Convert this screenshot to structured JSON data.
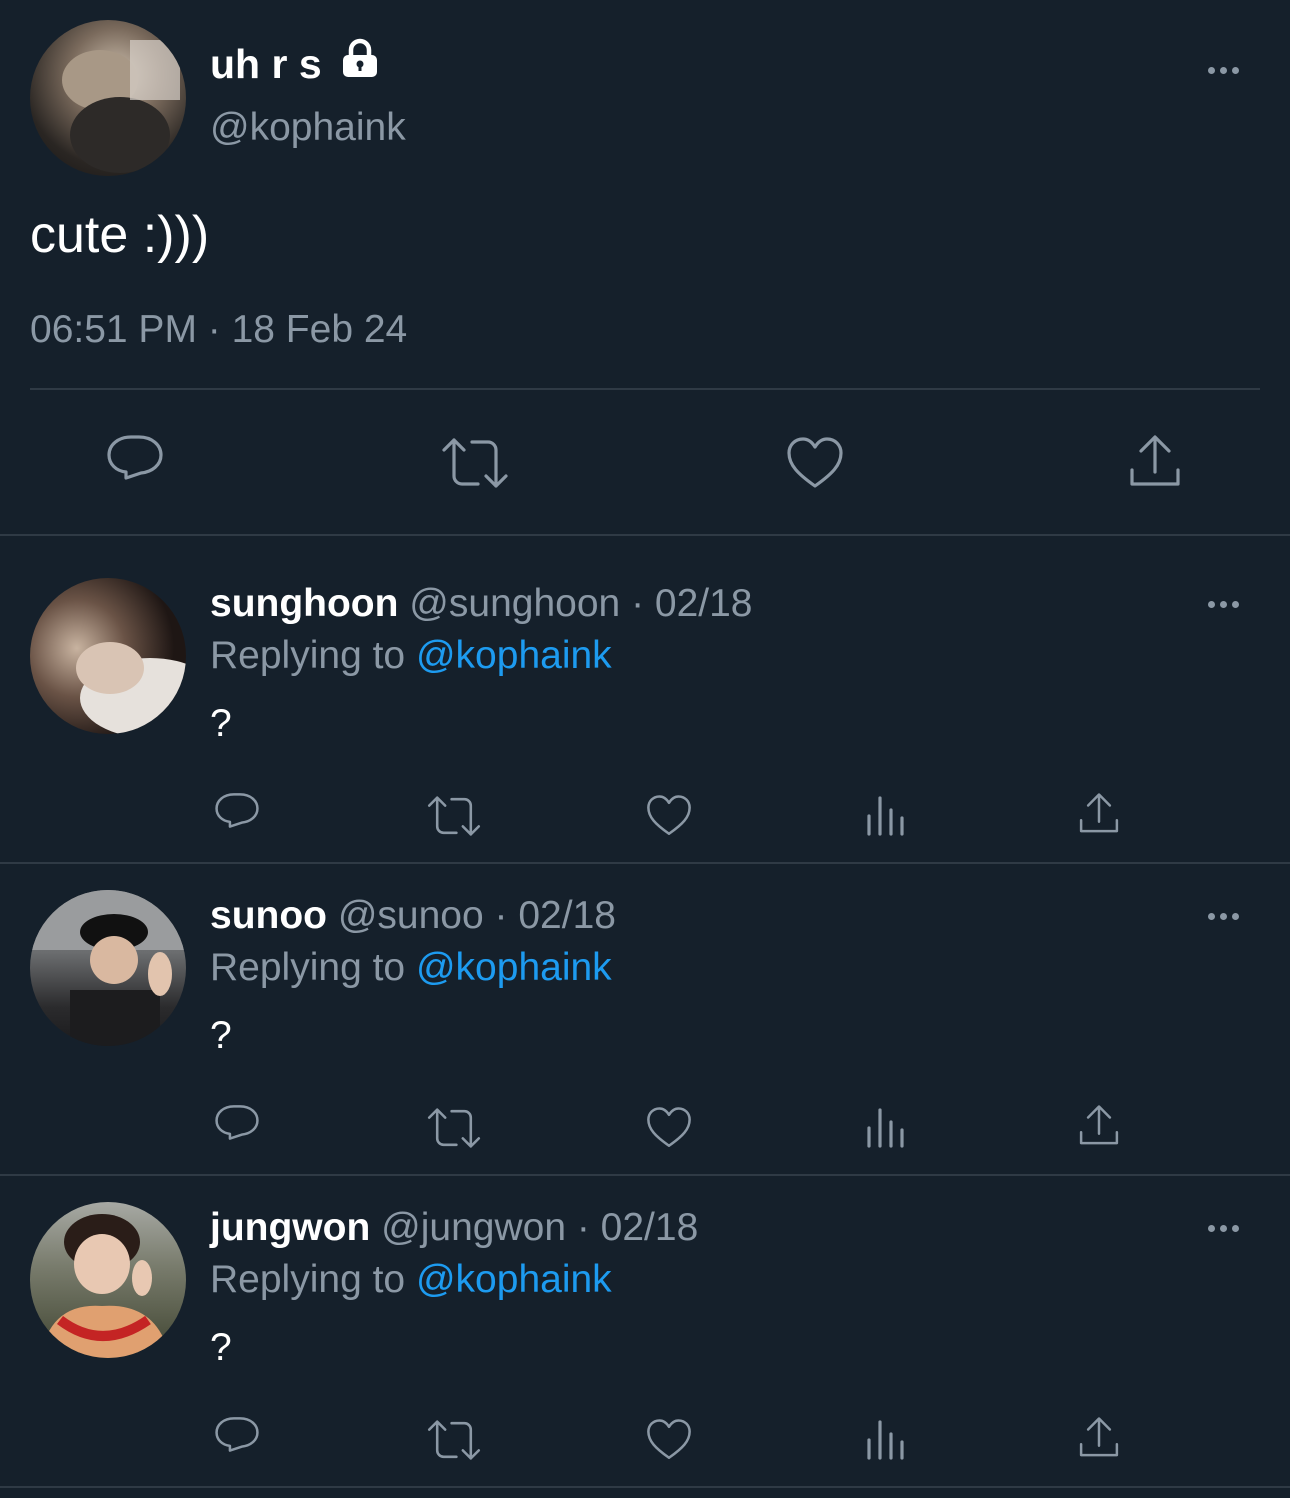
{
  "tweet": {
    "display_name": "uh r s",
    "handle": "@kophaink",
    "text": "cute :)))",
    "timestamp": "06:51 PM · 18 Feb 24",
    "avatar_icon": "profile-photo",
    "lock_icon": "lock-icon"
  },
  "replies": [
    {
      "name": "sunghoon",
      "handle": "@sunghoon",
      "date": "· 02/18",
      "replying_label": "Replying to",
      "replying_to": "@kophaink",
      "text": "?"
    },
    {
      "name": "sunoo",
      "handle": "@sunoo",
      "date": "· 02/18",
      "replying_label": "Replying to",
      "replying_to": "@kophaink",
      "text": "?"
    },
    {
      "name": "jungwon",
      "handle": "@jungwon",
      "date": "· 02/18",
      "replying_label": "Replying to",
      "replying_to": "@kophaink",
      "text": "?"
    }
  ],
  "colors": {
    "background": "#15202b",
    "muted": "#8b98a5",
    "link": "#1d9bf0",
    "divider": "#2f3a45"
  }
}
